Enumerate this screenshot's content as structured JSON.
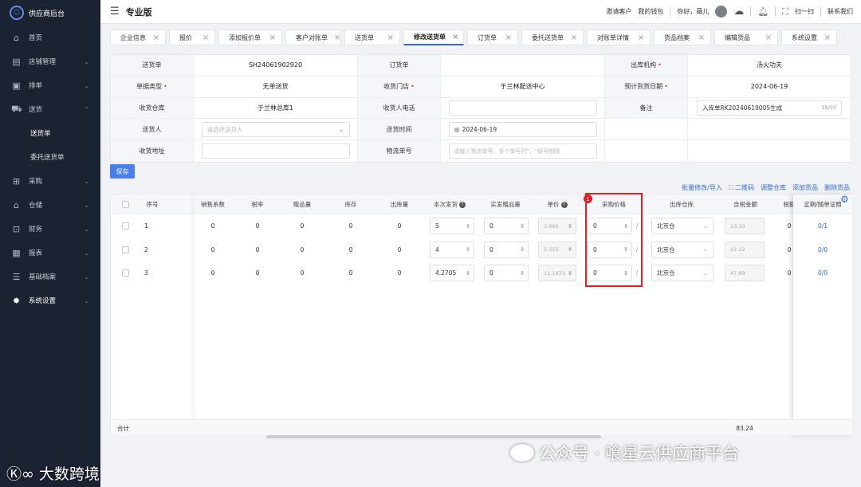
{
  "sidebar": {
    "brand": "供应商后台",
    "items": [
      {
        "label": "首页",
        "icon": "home-icon",
        "glyph": "⌂"
      },
      {
        "label": "店铺管理",
        "icon": "store-icon",
        "glyph": "▤",
        "chev": "⌄"
      },
      {
        "label": "排单",
        "icon": "schedule-icon",
        "glyph": "▣",
        "chev": "⌄"
      },
      {
        "label": "送货",
        "icon": "truck-icon",
        "glyph": "⛟",
        "chev": "⌃"
      },
      {
        "label": "送货单",
        "sub": true,
        "active": true
      },
      {
        "label": "委托送货单",
        "sub": true
      },
      {
        "label": "采购",
        "icon": "purchase-icon",
        "glyph": "⊞",
        "chev": "⌄"
      },
      {
        "label": "仓储",
        "icon": "warehouse-icon",
        "glyph": "⌂",
        "chev": "⌄"
      },
      {
        "label": "财务",
        "icon": "finance-icon",
        "glyph": "⊡",
        "chev": "⌄"
      },
      {
        "label": "报表",
        "icon": "report-icon",
        "glyph": "▦",
        "chev": "⌄"
      },
      {
        "label": "基础档案",
        "icon": "archive-icon",
        "glyph": "☰",
        "chev": "⌄"
      },
      {
        "label": "系统设置",
        "icon": "gear-icon",
        "glyph": "✹",
        "chev": "⌄",
        "bold": true
      }
    ]
  },
  "topbar": {
    "edition": "专业版",
    "invite": "邀请客户",
    "wallet": "我的钱包",
    "greeting": "你好，薇儿",
    "scan": "扫一扫",
    "contact": "联系我们"
  },
  "tabs": [
    {
      "label": "企业信息",
      "active": false
    },
    {
      "label": "报价",
      "active": false
    },
    {
      "label": "添加报价单",
      "active": false
    },
    {
      "label": "客户对账单",
      "active": false
    },
    {
      "label": "送货单",
      "active": false
    },
    {
      "label": "修改送货单",
      "active": true
    },
    {
      "label": "订货单",
      "active": false
    },
    {
      "label": "委托送货单",
      "active": false
    },
    {
      "label": "对账单详情",
      "active": false
    },
    {
      "label": "货品档案",
      "active": false
    },
    {
      "label": "编辑货品",
      "active": false
    },
    {
      "label": "系统设置",
      "active": false
    }
  ],
  "form": {
    "delivery_no_label": "送货单",
    "delivery_no": "SH24061902920",
    "order_label": "订货单",
    "order": "",
    "org_label": "出库机构",
    "org": "汤火功夫",
    "type_label": "单据类型",
    "type": "无单送货",
    "store_label": "收货门店",
    "store": "于兰林配送中心",
    "eta_label": "预计到货日期",
    "eta": "2024-06-19",
    "wh_label": "收货仓库",
    "wh": "于兰林总库1",
    "phone_label": "收货人电话",
    "phone": "",
    "remark_label": "备注",
    "remark": "入库单RK20240619005生成",
    "remark_count": "18/50",
    "sender_label": "送货人",
    "sender_placeholder": "请选择送货人",
    "time_label": "送货时间",
    "time": "2024-06-19",
    "addr_label": "收货地址",
    "addr": "",
    "logistics_label": "物流单号",
    "logistics_placeholder": "请输入物流单号，多个单号时\"，\"顿号相隔"
  },
  "save_label": "保存",
  "actions": [
    "批量修改/导入",
    "⛶ 二维码",
    "调整仓库",
    "添加货品",
    "删除货品"
  ],
  "table": {
    "headers": {
      "no": "序号",
      "coef": "销售系数",
      "tax": "税率",
      "gift": "赠品量",
      "stock": "库存",
      "out": "出库量",
      "ship": "本次发货",
      "actual_gift": "实发赠品量",
      "price": "单价",
      "purchase": "采购价格",
      "out_wh": "出库仓库",
      "tax_amount": "含税金额",
      "tax_short": "税额",
      "cert": "定期/随单证照"
    },
    "rows": [
      {
        "no": "1",
        "coef": "0",
        "tax": "0",
        "gift": "0",
        "stock": "0",
        "out": "0",
        "ship": "5",
        "actual_gift": "0",
        "price": "2.666",
        "purchase": "0",
        "wh": "北京仓",
        "amount": "13.33",
        "tax_amt": "0",
        "cert": "0/1"
      },
      {
        "no": "2",
        "coef": "0",
        "tax": "0",
        "gift": "0",
        "stock": "0",
        "out": "0",
        "ship": "4",
        "actual_gift": "0",
        "price": "5.555",
        "purchase": "0",
        "wh": "北京仓",
        "amount": "22.22",
        "tax_amt": "0",
        "cert": "0/0"
      },
      {
        "no": "3",
        "coef": "0",
        "tax": "0",
        "gift": "0",
        "stock": "0",
        "out": "0",
        "ship": "4.2705",
        "actual_gift": "0",
        "price": "11.1673",
        "purchase": "0",
        "wh": "北京仓",
        "amount": "47.69",
        "tax_amt": "0",
        "cert": "0/0"
      }
    ],
    "total_label": "合计",
    "total_amount": "83.24"
  },
  "annotation_badge": "1",
  "watermark": {
    "main": "公众号 · 喰星云供应商平台",
    "corner": "大数跨境",
    "corner_mark": "Ⓚ∞"
  },
  "colors": {
    "accent": "#2f6bd9",
    "highlight": "#e51c23",
    "sidebar": "#1b2231"
  }
}
